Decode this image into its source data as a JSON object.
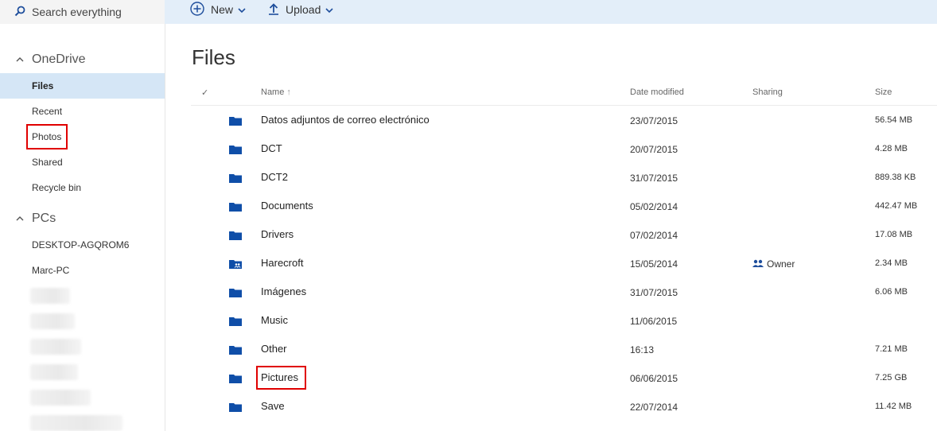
{
  "search": {
    "placeholder": "Search everything"
  },
  "commands": {
    "new_label": "New",
    "upload_label": "Upload"
  },
  "nav": {
    "onedrive_label": "OneDrive",
    "onedrive_items": [
      {
        "label": "Files",
        "selected": true
      },
      {
        "label": "Recent"
      },
      {
        "label": "Photos",
        "highlighted": true
      },
      {
        "label": "Shared"
      },
      {
        "label": "Recycle bin"
      }
    ],
    "pcs_label": "PCs",
    "pcs_items": [
      {
        "label": "DESKTOP-AGQROM6"
      },
      {
        "label": "Marc-PC"
      }
    ]
  },
  "main": {
    "title": "Files",
    "columns": {
      "check": "✓",
      "name": "Name",
      "sort_arrow": "↑",
      "date": "Date modified",
      "sharing": "Sharing",
      "size": "Size"
    },
    "files": [
      {
        "name": "Datos adjuntos de correo electrónico",
        "date": "23/07/2015",
        "sharing": "",
        "size": "56.54 MB",
        "icon": "folder-icon"
      },
      {
        "name": "DCT",
        "date": "20/07/2015",
        "sharing": "",
        "size": "4.28 MB",
        "icon": "folder-icon"
      },
      {
        "name": "DCT2",
        "date": "31/07/2015",
        "sharing": "",
        "size": "889.38 KB",
        "icon": "folder-icon"
      },
      {
        "name": "Documents",
        "date": "05/02/2014",
        "sharing": "",
        "size": "442.47 MB",
        "icon": "folder-icon"
      },
      {
        "name": "Drivers",
        "date": "07/02/2014",
        "sharing": "",
        "size": "17.08 MB",
        "icon": "folder-icon"
      },
      {
        "name": "Harecroft",
        "date": "15/05/2014",
        "sharing": "Owner",
        "size": "2.34 MB",
        "icon": "shared-folder-icon"
      },
      {
        "name": "Imágenes",
        "date": "31/07/2015",
        "sharing": "",
        "size": "6.06 MB",
        "icon": "folder-icon"
      },
      {
        "name": "Music",
        "date": "11/06/2015",
        "sharing": "",
        "size": "",
        "icon": "folder-icon"
      },
      {
        "name": "Other",
        "date": "16:13",
        "sharing": "",
        "size": "7.21 MB",
        "icon": "folder-icon"
      },
      {
        "name": "Pictures",
        "date": "06/06/2015",
        "sharing": "",
        "size": "7.25 GB",
        "icon": "folder-icon",
        "highlighted": true
      },
      {
        "name": "Save",
        "date": "22/07/2014",
        "sharing": "",
        "size": "11.42 MB",
        "icon": "folder-icon"
      }
    ]
  },
  "colors": {
    "accent": "#0f4ea8",
    "highlight_box": "#e00000",
    "selected_nav": "#d5e6f6",
    "topbar": "#e3eef9"
  }
}
